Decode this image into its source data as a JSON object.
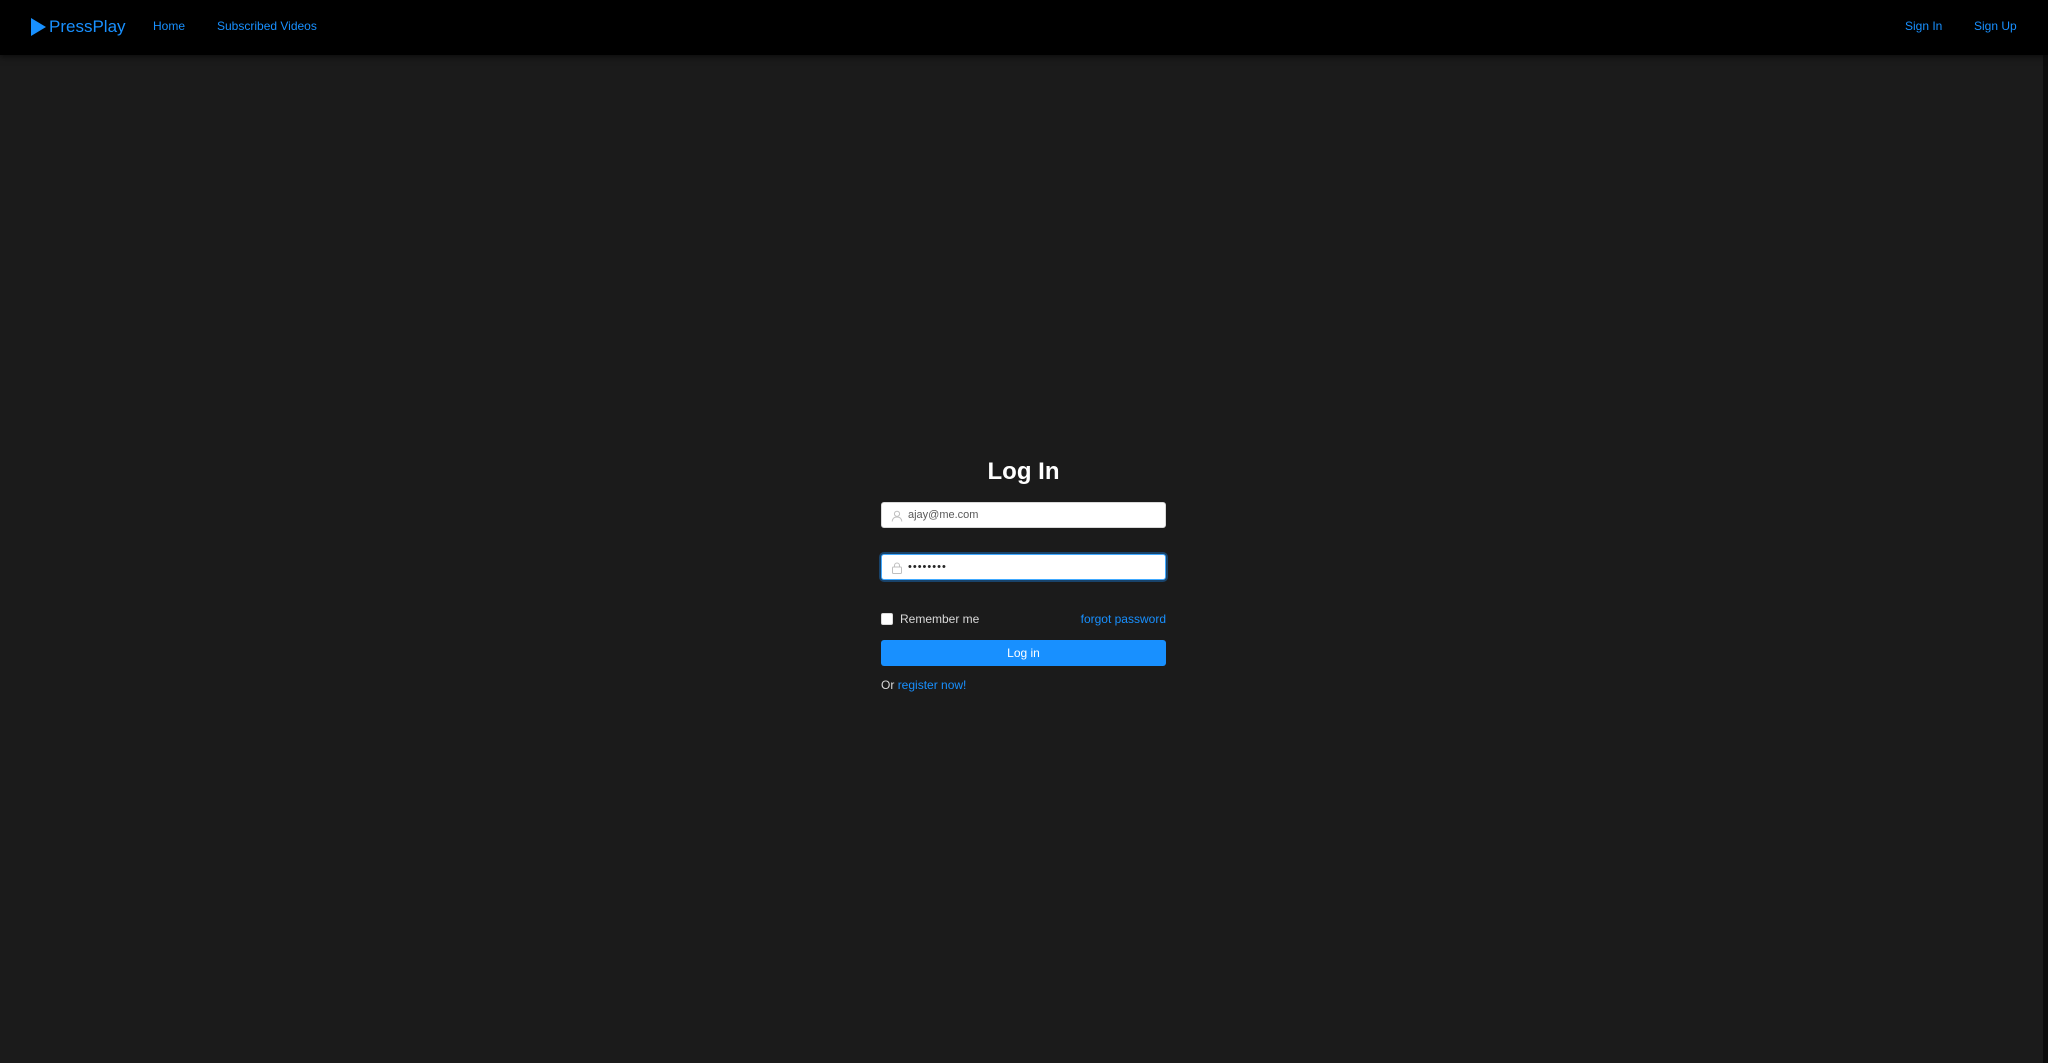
{
  "brand": {
    "name": "PressPlay",
    "accent_color": "#1890ff",
    "logo_icon": "play-triangle-icon"
  },
  "nav": {
    "home": "Home",
    "subscribed": "Subscribed Videos",
    "sign_in": "Sign In",
    "sign_up": "Sign Up"
  },
  "login": {
    "title": "Log In",
    "email": {
      "value": "ajay@me.com",
      "icon": "user-icon"
    },
    "password": {
      "value": "••••••••",
      "icon": "lock-icon"
    },
    "remember_label": "Remember me",
    "remember_checked": false,
    "forgot_label": "forgot password",
    "submit_label": "Log in",
    "register_prefix": "Or",
    "register_link": "register now!"
  },
  "colors": {
    "header_bg": "#000000",
    "page_bg": "#1b1b1b",
    "link": "#1890ff",
    "button_bg": "#1890ff"
  }
}
